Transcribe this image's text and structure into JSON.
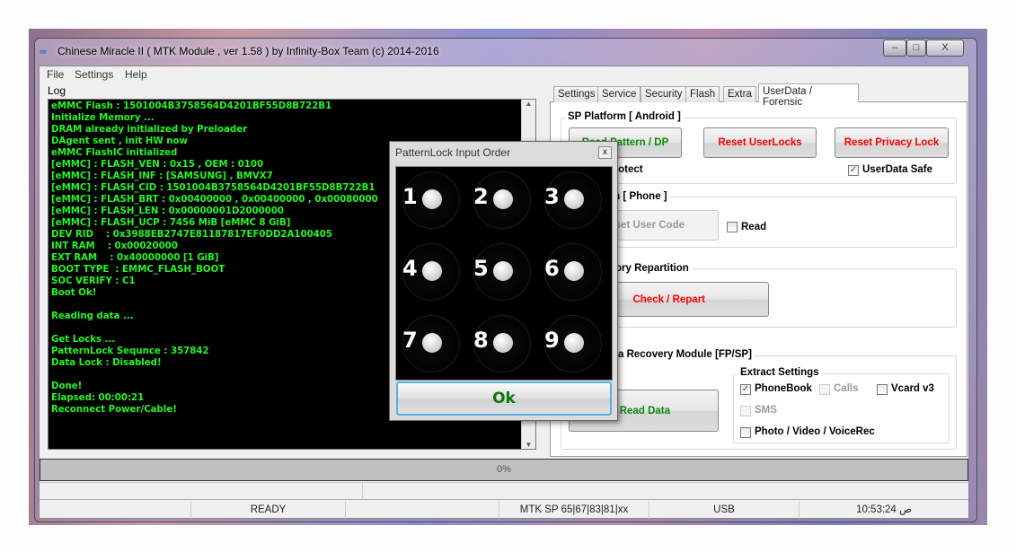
{
  "window": {
    "title": "Chinese Miracle II ( MTK Module , ver 1.58 ) by Infinity-Box Team (c) 2014-2016",
    "minimize": "–",
    "maximize": "□",
    "close": "X"
  },
  "menu": [
    "File",
    "Settings",
    "Help"
  ],
  "log": {
    "label": "Log",
    "lines": [
      "eMMC Flash : 1501004B3758564D4201BF55D8B722B1",
      "Initialize Memory ...",
      "DRAM already initialized by Preloader",
      "DAgent sent , init HW now",
      "eMMC FlashIC initialized",
      "[eMMC] : FLASH_VEN : 0x15 , OEM : 0100",
      "[eMMC] : FLASH_INF : [SAMSUNG] , BMVX7",
      "[eMMC] : FLASH_CID : 1501004B3758564D4201BF55D8B722B1",
      "[eMMC] : FLASH_BRT : 0x00400000 , 0x00400000 , 0x00080000",
      "[eMMC] : FLASH_LEN : 0x00000001D2000000",
      "[eMMC] : FLASH_UCP : 7456 MiB [eMMC 8 GiB]",
      "DEV RID    : 0x3988EB2747E81187817EF0DD2A100405",
      "INT RAM    : 0x00020000",
      "EXT RAM    : 0x40000000 [1 GiB]",
      "BOOT TYPE  : EMMC_FLASH_BOOT",
      "SOC VERIFY : C1",
      "Boot Ok!",
      "",
      "Reading data ...",
      "",
      "Get Locks ...",
      "PatternLock Sequnce : 357842",
      "Data Lock : Disabled!",
      "",
      "Done!",
      "Elapsed: 00:00:21",
      "Reconnect Power/Cable!"
    ]
  },
  "tabs": [
    "Settings",
    "Service",
    "Security",
    "Flash",
    "Extra",
    "UserData / Forensic"
  ],
  "active_tab": "UserData / Forensic",
  "sp_platform": {
    "title": "SP Platform [ Android ]",
    "read_pattern": "Read Pattern / DP",
    "reset_userlocks": "Reset UserLocks",
    "reset_privacy": "Reset Privacy Lock",
    "protect": "Protect",
    "userdata_safe": "UserData Safe",
    "userdata_safe_checked": true
  },
  "phone": {
    "title": "m [ Phone ]",
    "reset_user_code": "Reset User Code",
    "read": "Read",
    "read_checked": false
  },
  "repartition": {
    "title": "ory Repartition",
    "check_repart": "Check / Repart"
  },
  "recovery": {
    "title": "a Recovery Module  [FP/SP]",
    "read_data": "Read Data",
    "extract_title": "Extract Settings",
    "phonebook": "PhoneBook",
    "phonebook_checked": true,
    "calls": "Calls",
    "vcard": "Vcard v3",
    "sms": "SMS",
    "media": "Photo / Video / VoiceRec"
  },
  "progress": {
    "value": 0,
    "label": "0%"
  },
  "status": {
    "state": "READY",
    "chip": "MTK SP 65|67|83|81|xx",
    "port": "USB",
    "time": "10:53:24 ص"
  },
  "dialog": {
    "title": "PatternLock Input Order",
    "close": "x",
    "numbers": [
      "1",
      "2",
      "3",
      "4",
      "5",
      "6",
      "7",
      "8",
      "9"
    ],
    "ok": "Ok"
  },
  "colors": {
    "log_text": "#22f522",
    "danger_label": "#ff0000",
    "ok_label": "#0a7a0a"
  }
}
